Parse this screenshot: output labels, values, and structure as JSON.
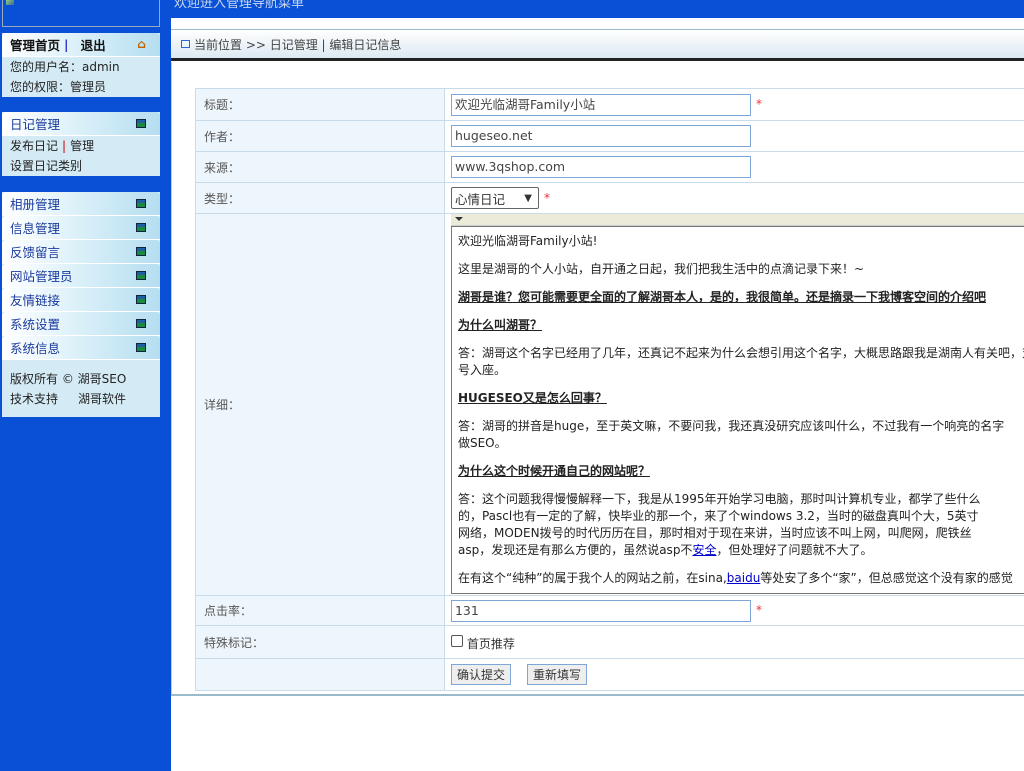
{
  "banner": {
    "alt": "欢迎进入管理导航菜单"
  },
  "sidebar": {
    "home": {
      "title": "管理首页",
      "logout": "退出",
      "sep": "|",
      "user_label": "您的用户名：admin",
      "role_label": "您的权限：管理员"
    },
    "diary": {
      "title": "日记管理",
      "publish": "发布日记",
      "sep": "|",
      "manage": "管理",
      "category": "设置日记类别"
    },
    "menus": [
      "相册管理",
      "信息管理",
      "反馈留言",
      "网站管理员",
      "友情链接",
      "系统设置",
      "系统信息"
    ],
    "footer": {
      "copyright": "版权所有 © 湖哥SEO",
      "support": "技术支持",
      "support_name": "湖哥软件"
    }
  },
  "breadcrumb": "当前位置 >> 日记管理 | 编辑日记信息",
  "form": {
    "title_label": "标题：",
    "title_value": "欢迎光临湖哥Family小站",
    "author_label": "作者：",
    "author_value": "hugeseo.net",
    "source_label": "来源：",
    "source_value": "www.3qshop.com",
    "type_label": "类型：",
    "type_value": "心情日记",
    "detail_label": "详细：",
    "clicks_label": "点击率：",
    "clicks_value": "131",
    "mark_label": "特殊标记：",
    "mark_option": "首页推荐",
    "required": "*",
    "submit": "确认提交",
    "reset": "重新填写"
  },
  "editor": {
    "p1": "欢迎光临湖哥Family小站!",
    "p2": "这里是湖哥的个人小站，自开通之日起，我们把我生活中的点滴记录下来！~",
    "h1": "湖哥是谁？您可能需要更全面的了解湖哥本人，是的，我很简单。还是摘录一下我博客空间的介绍吧",
    "h2": "为什么叫湖哥？",
    "a2_1": "答：湖哥这个名字已经用了几年，还真记不起来为什么会想引用这个名字，大概思路跟我是湖南人有关吧，对",
    "a2_2": "号入座。",
    "h3": "HUGESEO又是怎么回事？",
    "a3_1": "答：湖哥的拼音是huge，至于英文嘛，不要问我，我还真没研究应该叫什么，不过我有一个响亮的名字",
    "a3_2": "做SEO。",
    "h4": "为什么这个时候开通自己的网站呢？",
    "a4_1": "答：这个问题我得慢慢解释一下，我是从1995年开始学习电脑，那时叫计算机专业，都学了些什么",
    "a4_2": "的，Pascl也有一定的了解，快毕业的那一个，来了个windows 3.2，当时的磁盘真叫个大，5英寸",
    "a4_3": "网络，MODEN拨号的时代历历在目，那时相对于现在来讲，当时应该不叫上网，叫爬网，爬铁丝",
    "a4_4a": "asp，发现还是有那么方便的，虽然说asp不",
    "a4_link": "安全",
    "a4_4b": "，但处理好了问题就不大了。",
    "a5a": "在有这个“纯种”的属于我个人的网站之前，在sina,",
    "a5_link": "baidu",
    "a5b": "等处安了多个“家”，但总感觉这个没有家的感觉"
  }
}
